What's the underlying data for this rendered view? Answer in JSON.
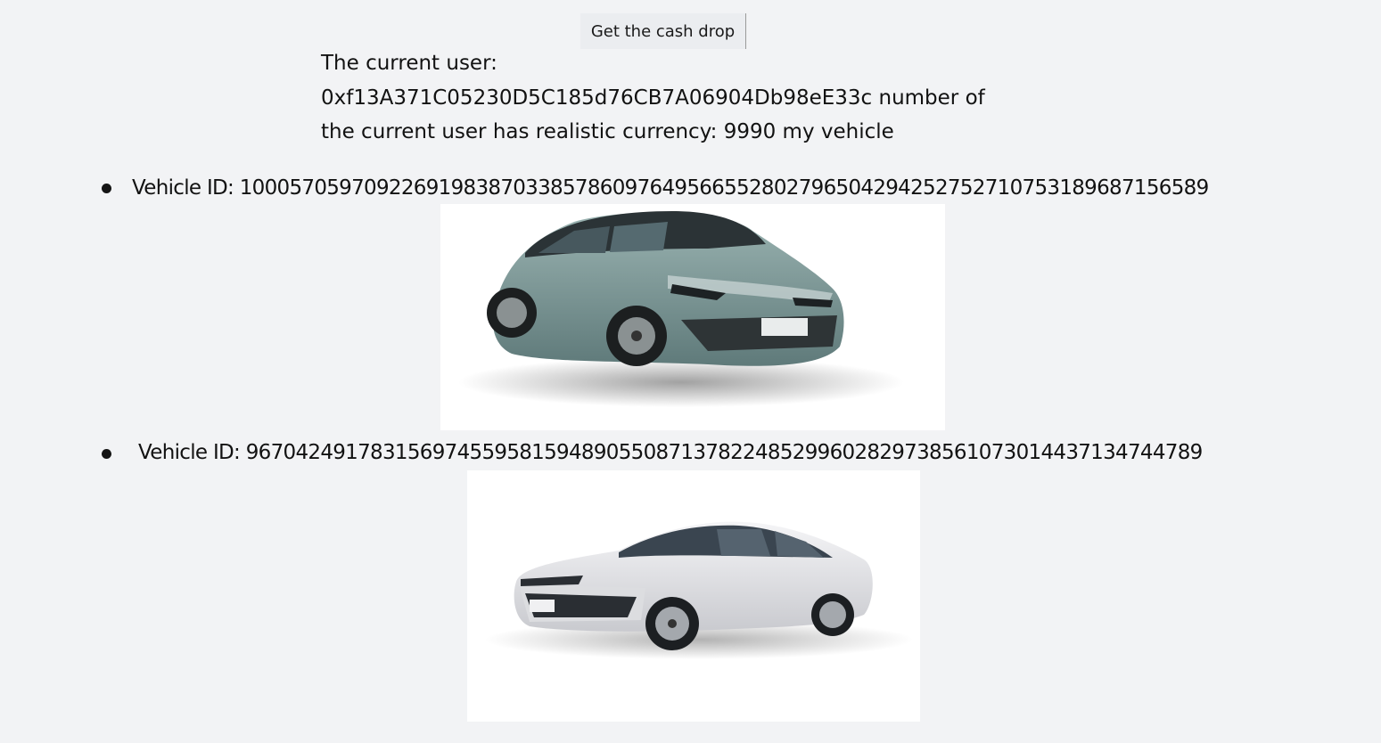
{
  "header": {
    "cash_drop_button": "Get the cash drop"
  },
  "user_info": {
    "line1": "The current user:",
    "line2": "0xf13A371C05230D5C185d76CB7A06904Db98eE33c number of",
    "line3": "the current user has realistic currency: 9990 my vehicle"
  },
  "vehicles": [
    {
      "id_text": "Vehicle ID: 100057059709226919838703385786097649566552802796504294252752710753189687156589",
      "image": "teal-electric-coupe-suv",
      "body_color": "#7f9a99"
    },
    {
      "id_text": "Vehicle ID: 96704249178315697455958159489055087137822485299602829738561073014437134744789",
      "image": "white-sedan",
      "body_color": "#e6e7ea"
    }
  ],
  "colors": {
    "background": "#f2f3f5",
    "button_bg": "#ebedf0"
  }
}
